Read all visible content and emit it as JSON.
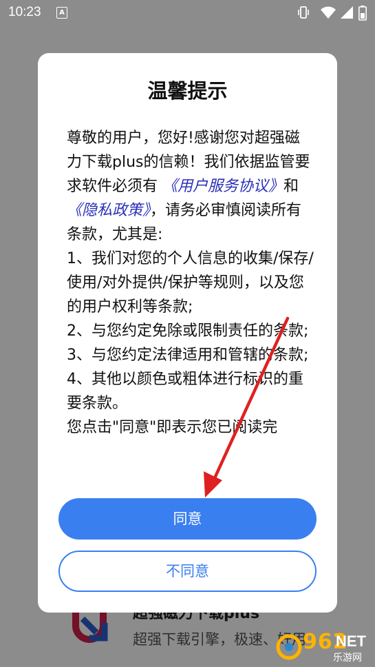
{
  "status_bar": {
    "time": "10:23",
    "indicator_letter": "A",
    "icons": [
      "vibrate-icon",
      "wifi-icon",
      "signal-icon",
      "battery-icon"
    ]
  },
  "background_app": {
    "title": "超强磁力下载plus",
    "subtitle": "超强下载引擎，极速、好用"
  },
  "dialog": {
    "title": "温馨提示",
    "body": {
      "p1_before": "尊敬的用户，您好!感谢您对超强磁力下载plus的信赖！我们依据监管要求软件必须有",
      "link_terms": "《用户服务协议》",
      "p1_and": "和",
      "link_privacy": "《隐私政策》",
      "p1_after": "，请务必审慎阅读所有条款，尤其是:",
      "item1": "1、我们对您的个人信息的收集/保存/使用/对外提供/保护等规则，以及您的用户权利等条款;",
      "item2": "2、与您约定免除或限制责任的条款;",
      "item3": "3、与您约定法律适用和管辖的条款;",
      "item4": "4、其他以颜色或粗体进行标识的重要条款。",
      "item5": "您点击\"同意\"即表示您已阅读完"
    },
    "agree_label": "同意",
    "disagree_label": "不同意"
  },
  "watermark": {
    "number": "962",
    "net": "NET",
    "cn": "乐游网"
  },
  "colors": {
    "accent": "#3a7ff0",
    "link": "#2a2fb8",
    "annotation_arrow": "#e02020"
  }
}
